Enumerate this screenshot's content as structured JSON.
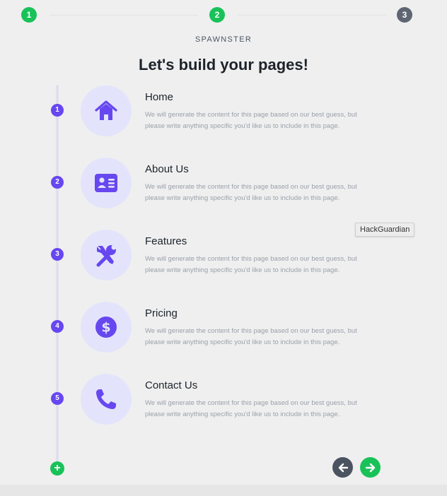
{
  "stepper": {
    "steps": [
      {
        "label": "1",
        "state": "complete"
      },
      {
        "label": "2",
        "state": "current"
      },
      {
        "label": "3",
        "state": "upcoming"
      }
    ]
  },
  "brand": "SPAWNSTER",
  "title": "Let's build your pages!",
  "pages": [
    {
      "number": "1",
      "name": "Home",
      "icon": "home-icon",
      "description": "We will generate the content for this page based on our best guess, but please write anything specific you'd like us to include in this page."
    },
    {
      "number": "2",
      "name": "About Us",
      "icon": "id-card-icon",
      "description": "We will generate the content for this page based on our best guess, but please write anything specific you'd like us to include in this page."
    },
    {
      "number": "3",
      "name": "Features",
      "icon": "tools-icon",
      "description": "We will generate the content for this page based on our best guess, but please write anything specific you'd like us to include in this page."
    },
    {
      "number": "4",
      "name": "Pricing",
      "icon": "dollar-icon",
      "description": "We will generate the content for this page based on our best guess, but please write anything specific you'd like us to include in this page."
    },
    {
      "number": "5",
      "name": "Contact Us",
      "icon": "phone-icon",
      "description": "We will generate the content for this page based on our best guess, but please write anything specific you'd like us to include in this page."
    }
  ],
  "add_button": {
    "label": "+"
  },
  "tooltip": "HackGuardian",
  "nav": {
    "back_icon": "arrow-left-icon",
    "next_icon": "arrow-right-icon"
  },
  "colors": {
    "accent": "#6747f0",
    "success": "#19c259",
    "bubble": "#e3e4fb",
    "muted": "#5f6573"
  }
}
